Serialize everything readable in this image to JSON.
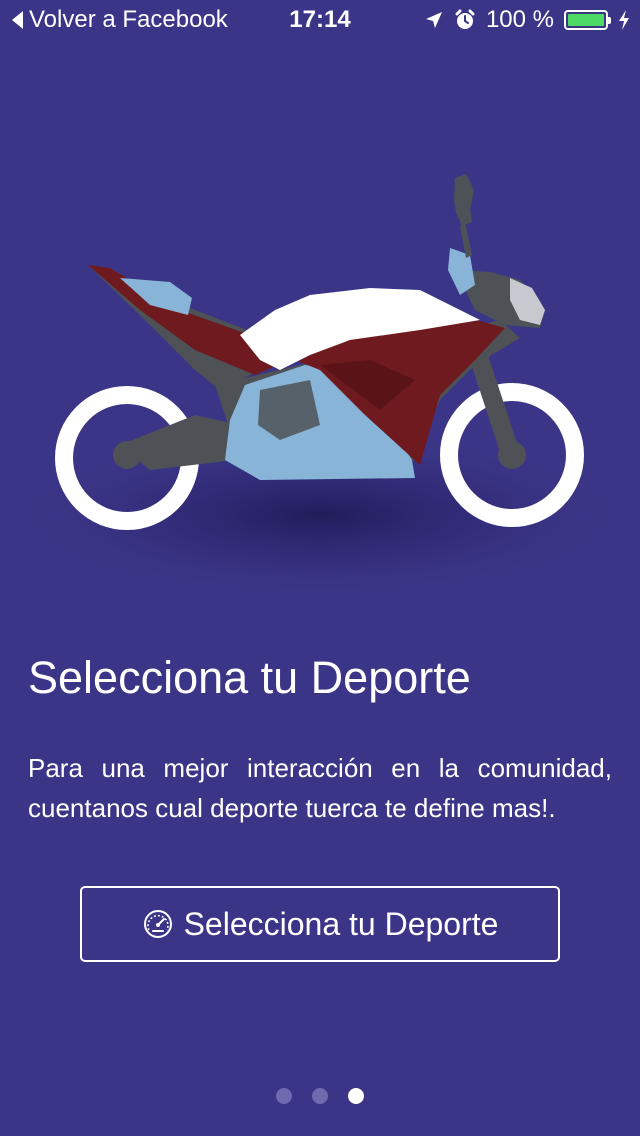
{
  "status_bar": {
    "back_label": "Volver a Facebook",
    "time": "17:14",
    "battery_text": "100 %",
    "battery_level": 1.0,
    "icons": [
      "location-arrow-icon",
      "alarm-icon",
      "battery-icon",
      "charging-bolt-icon"
    ]
  },
  "illustration": {
    "subject": "motorcycle-illustration",
    "colors": {
      "body_dark": "#4e5256",
      "fairing_red": "#6e1a1f",
      "panel_blue": "#88b4d8",
      "tank_white": "#ffffff",
      "wheel": "#ffffff"
    }
  },
  "onboarding": {
    "title": "Selecciona tu Deporte",
    "description": "Para una mejor interacción en la comunidad, cuentanos cual deporte tuerca te define mas!.",
    "button_label": "Selecciona tu Deporte",
    "button_icon": "speedometer-icon"
  },
  "pagination": {
    "total": 3,
    "current": 3
  },
  "colors": {
    "background": "#3b3587",
    "accent": "#ffffff",
    "dot_inactive": "#6f6ab0",
    "battery_fill": "#4cd964"
  }
}
